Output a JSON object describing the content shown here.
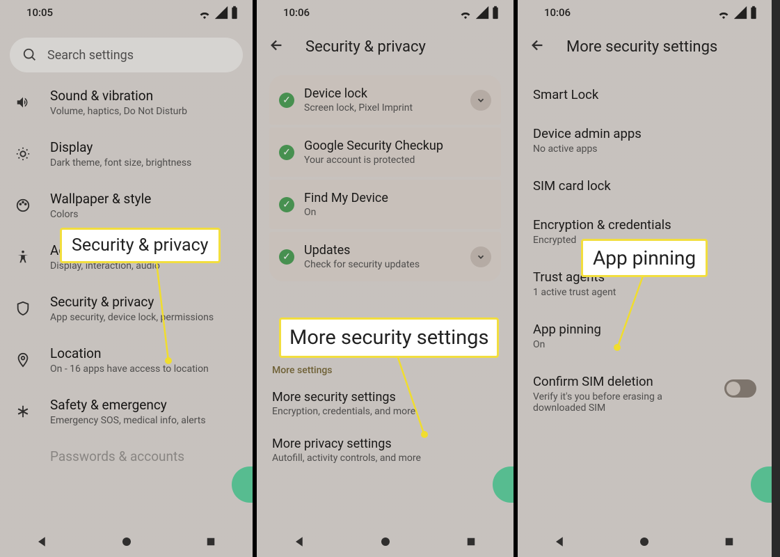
{
  "status": {
    "time1": "10:05",
    "time2": "10:06",
    "time3": "10:06"
  },
  "screen1": {
    "search_placeholder": "Search settings",
    "items": [
      {
        "title": "Sound & vibration",
        "sub": "Volume, haptics, Do Not Disturb",
        "icon": "volume-icon"
      },
      {
        "title": "Display",
        "sub": "Dark theme, font size, brightness",
        "icon": "brightness-icon"
      },
      {
        "title": "Wallpaper & style",
        "sub": "Colors",
        "icon": "palette-icon"
      },
      {
        "title": "Accessibility",
        "sub": "Display, interaction, audio",
        "icon": "accessibility-icon"
      },
      {
        "title": "Security & privacy",
        "sub": "App security, device lock, permissions",
        "icon": "shield-icon"
      },
      {
        "title": "Location",
        "sub": "On - 16 apps have access to location",
        "icon": "location-icon"
      },
      {
        "title": "Safety & emergency",
        "sub": "Emergency SOS, medical info, alerts",
        "icon": "asterisk-icon"
      },
      {
        "title": "Passwords & accounts",
        "sub": "",
        "icon": "key-icon"
      }
    ]
  },
  "screen2": {
    "title": "Security & privacy",
    "cards": [
      {
        "title": "Device lock",
        "sub": "Screen lock, Pixel Imprint",
        "expand": true
      },
      {
        "title": "Google Security Checkup",
        "sub": "Your account is protected",
        "expand": false
      },
      {
        "title": "Find My Device",
        "sub": "On",
        "expand": false
      },
      {
        "title": "Updates",
        "sub": "Check for security updates",
        "expand": true
      }
    ],
    "section_label": "More settings",
    "more": [
      {
        "title": "More security settings",
        "sub": "Encryption, credentials, and more"
      },
      {
        "title": "More privacy settings",
        "sub": "Autofill, activity controls, and more"
      }
    ]
  },
  "screen3": {
    "title": "More security settings",
    "items": [
      {
        "title": "Smart Lock",
        "sub": ""
      },
      {
        "title": "Device admin apps",
        "sub": "No active apps"
      },
      {
        "title": "SIM card lock",
        "sub": ""
      },
      {
        "title": "Encryption & credentials",
        "sub": "Encrypted"
      },
      {
        "title": "Trust agents",
        "sub": "1 active trust agent"
      },
      {
        "title": "App pinning",
        "sub": "On"
      },
      {
        "title": "Confirm SIM deletion",
        "sub": "Verify it's you before erasing a downloaded SIM",
        "toggle": true
      }
    ]
  },
  "callouts": {
    "c1": "Security & privacy",
    "c2": "More security settings",
    "c3": "App pinning"
  }
}
